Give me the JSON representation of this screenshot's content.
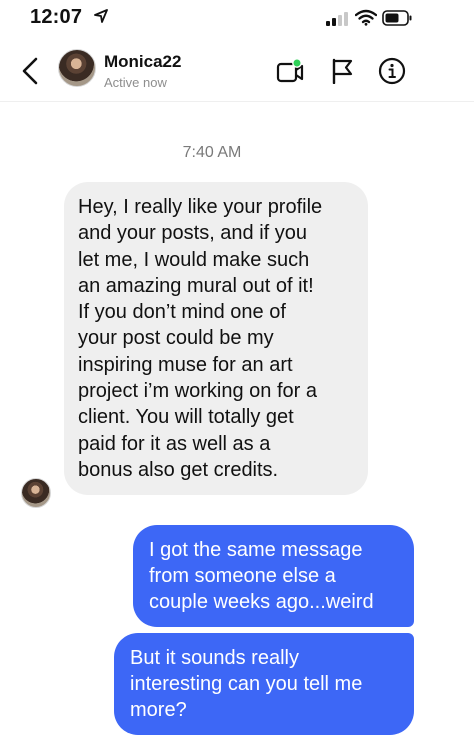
{
  "status_bar": {
    "time": "12:07",
    "icons": [
      "location-arrow-icon",
      "signal-icon",
      "wifi-icon",
      "battery-icon"
    ]
  },
  "header": {
    "contact_name": "Monica22",
    "presence": "Active now",
    "icons": [
      "back-chevron-icon",
      "video-call-icon",
      "flag-icon",
      "info-icon"
    ],
    "presence_dot_color": "#2fd158"
  },
  "chat": {
    "timestamp": "7:40 AM",
    "messages": [
      {
        "direction": "incoming",
        "lines": [
          "Hey, I really like your profile",
          "and your posts, and if you",
          "let me, I would make such",
          "an amazing mural out of it!",
          "If you don’t mind one of",
          "your post could be my",
          "inspiring muse for an art",
          "project i’m working on for a",
          "client. You will totally get",
          "paid for it as well as a",
          "bonus also get credits."
        ]
      },
      {
        "direction": "outgoing",
        "lines": [
          "I got the same message",
          "from someone else a",
          "couple weeks ago...weird"
        ]
      },
      {
        "direction": "outgoing",
        "lines": [
          "But it sounds really",
          "interesting can you tell me",
          "more?"
        ]
      }
    ]
  },
  "colors": {
    "outgoing_bubble": "#3d67f6",
    "incoming_bubble": "#efefef",
    "secondary_text": "#8e8e8e"
  }
}
